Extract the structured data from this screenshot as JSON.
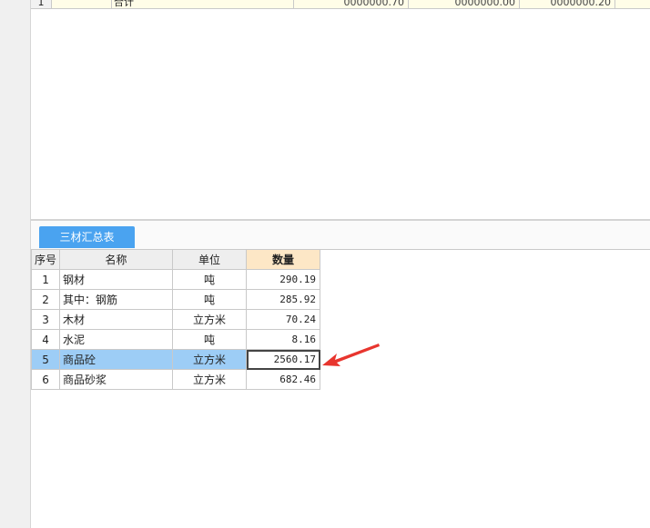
{
  "top_grid": {
    "row_number": "1",
    "label": "合计",
    "values": [
      "0000000.70",
      "0000000.00",
      "0000000.20"
    ]
  },
  "tabs": [
    {
      "label": "三材汇总表"
    }
  ],
  "summary_table": {
    "headers": {
      "index": "序号",
      "name": "名称",
      "unit": "单位",
      "quantity": "数量"
    },
    "rows": [
      {
        "index": "1",
        "name": "钢材",
        "unit": "吨",
        "quantity": "290.19"
      },
      {
        "index": "2",
        "name": "其中：钢筋",
        "unit": "吨",
        "quantity": "285.92"
      },
      {
        "index": "3",
        "name": "木材",
        "unit": "立方米",
        "quantity": "70.24"
      },
      {
        "index": "4",
        "name": "水泥",
        "unit": "吨",
        "quantity": "8.16"
      },
      {
        "index": "5",
        "name": "商品砼",
        "unit": "立方米",
        "quantity": "2560.17"
      },
      {
        "index": "6",
        "name": "商品砂浆",
        "unit": "立方米",
        "quantity": "682.46"
      }
    ],
    "selected_row": 5
  },
  "colors": {
    "tab_active": "#4aa3f0",
    "selected_row": "#9dcdf6",
    "quantity_header": "#fde7c6",
    "arrow": "#e8352e"
  }
}
